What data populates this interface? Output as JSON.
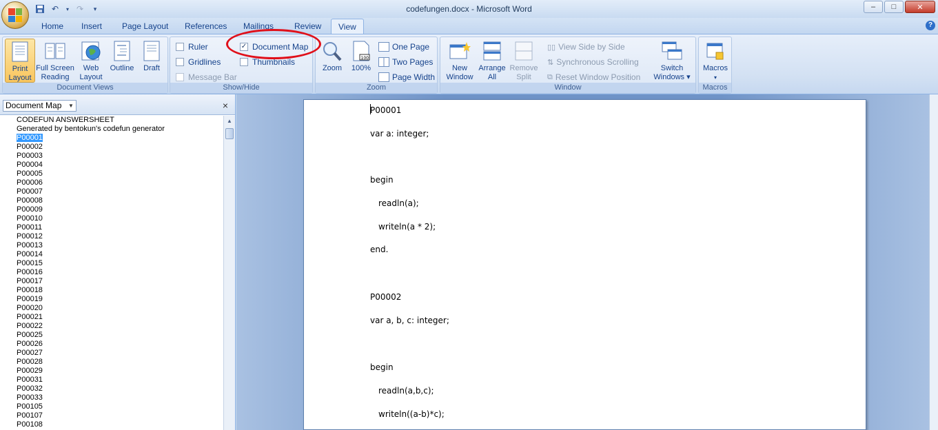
{
  "window": {
    "title": "codefungen.docx - Microsoft Word",
    "qat_icons": [
      "save-icon",
      "undo-icon",
      "redo-icon",
      "customize-icon"
    ]
  },
  "tabs": [
    {
      "label": "Home",
      "active": false
    },
    {
      "label": "Insert",
      "active": false
    },
    {
      "label": "Page Layout",
      "active": false
    },
    {
      "label": "References",
      "active": false
    },
    {
      "label": "Mailings",
      "active": false
    },
    {
      "label": "Review",
      "active": false
    },
    {
      "label": "View",
      "active": true
    }
  ],
  "ribbon": {
    "document_views": {
      "label": "Document Views",
      "print_layout": "Print\nLayout",
      "full_screen": "Full Screen\nReading",
      "web_layout": "Web\nLayout",
      "outline": "Outline",
      "draft": "Draft"
    },
    "show_hide": {
      "label": "Show/Hide",
      "ruler": "Ruler",
      "gridlines": "Gridlines",
      "message_bar": "Message Bar",
      "document_map": "Document Map",
      "thumbnails": "Thumbnails",
      "document_map_checked": true
    },
    "zoom": {
      "label": "Zoom",
      "zoom": "Zoom",
      "pct": "100%",
      "one_page": "One Page",
      "two_pages": "Two Pages",
      "page_width": "Page Width"
    },
    "window": {
      "label": "Window",
      "new_window": "New\nWindow",
      "arrange_all": "Arrange\nAll",
      "remove_split": "Remove\nSplit",
      "side_by_side": "View Side by Side",
      "sync_scroll": "Synchronous Scrolling",
      "reset_pos": "Reset Window Position",
      "switch_windows": "Switch\nWindows ▾"
    },
    "macros": {
      "label": "Macros",
      "macros": "Macros"
    }
  },
  "docmap": {
    "selector": "Document Map",
    "close": "×",
    "items": [
      "CODEFUN ANSWERSHEET",
      "Generated by bentokun's codefun generator",
      "P00001",
      "P00002",
      "P00003",
      "P00004",
      "P00005",
      "P00006",
      "P00007",
      "P00008",
      "P00009",
      "P00010",
      "P00011",
      "P00012",
      "P00013",
      "P00014",
      "P00015",
      "P00016",
      "P00017",
      "P00018",
      "P00019",
      "P00020",
      "P00021",
      "P00022",
      "P00025",
      "P00026",
      "P00027",
      "P00028",
      "P00029",
      "P00031",
      "P00032",
      "P00033",
      "P00105",
      "P00107",
      "P00108"
    ],
    "selected_index": 2
  },
  "document": {
    "lines": [
      {
        "text": "P00001"
      },
      {
        "text": "var a: integer;"
      },
      {
        "text": "begin"
      },
      {
        "text": "readln(a);",
        "indent": true
      },
      {
        "text": "writeln(a * 2);",
        "indent": true
      },
      {
        "text": "end."
      },
      {
        "text": "P00002"
      },
      {
        "text": "var a, b, c: integer;"
      },
      {
        "text": "begin"
      },
      {
        "text": "readln(a,b,c);",
        "indent": true
      },
      {
        "text": "writeln((a-b)*c);",
        "indent": true
      }
    ]
  }
}
